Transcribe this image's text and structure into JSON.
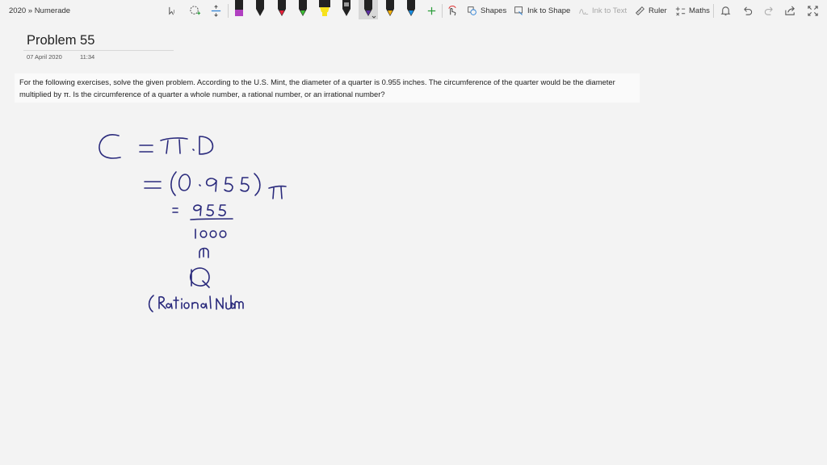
{
  "breadcrumb": "2020 » Numerade",
  "toolbar": {
    "icons": [
      "lasso-select-icon",
      "lasso-plus-icon",
      "add-space-icon",
      "pen-icon",
      "add-pen-icon",
      "ink-replay-icon",
      "shapes-icon",
      "ink-to-shape-icon",
      "ink-to-text-icon",
      "ruler-icon",
      "maths-icon",
      "bell-icon",
      "undo-icon",
      "redo-icon",
      "share-icon",
      "fullscreen-icon"
    ],
    "pens": [
      {
        "color": "#b040c0"
      },
      {
        "color": "#222222"
      },
      {
        "color": "#e8223c"
      },
      {
        "color": "#3dbe35"
      },
      {
        "color": "#f7e21c"
      },
      {
        "color": "#9a9a9a"
      },
      {
        "color": "#5b2fa0",
        "selected": true
      },
      {
        "color": "#f6b10d"
      },
      {
        "color": "#1a8fe3"
      }
    ],
    "shapes_label": "Shapes",
    "ink_to_shape_label": "Ink to Shape",
    "ink_to_text_label": "Ink to Text",
    "ruler_label": "Ruler",
    "maths_label": "Maths"
  },
  "page": {
    "title": "Problem 55",
    "date": "07 April 2020",
    "time": "11:34"
  },
  "problem": {
    "text_line1": "For the following exercises, solve the given problem. According to the U.S. Mint, the diameter of a quarter is 0.955 inches. The circumference of the quarter would be the diameter",
    "text_line2": "multiplied by π. Is the circumference of a quarter a whole number, a rational number, or an irrational number?"
  },
  "ink_color": "#2a2a7c"
}
